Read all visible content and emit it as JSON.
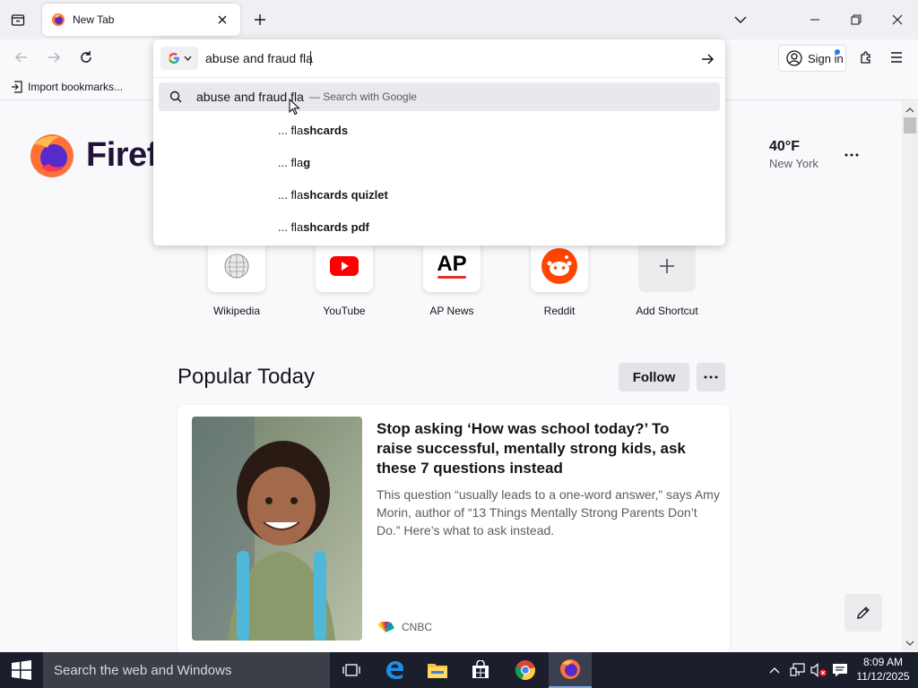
{
  "browser": {
    "tab": {
      "title": "New Tab"
    },
    "signin_label": "Sign in",
    "bookmarks_import": "Import bookmarks..."
  },
  "urlbar": {
    "value": "abuse and fraud fla",
    "main_suggestion": {
      "query": "abuse and fraud fla",
      "action": "— Search with Google"
    },
    "suggestions": [
      {
        "prefix": "... fla",
        "completion": "shcards"
      },
      {
        "prefix": "... fla",
        "completion": "g"
      },
      {
        "prefix": "... fla",
        "completion": "shcards quizlet"
      },
      {
        "prefix": "... fla",
        "completion": "shcards pdf"
      }
    ]
  },
  "newtab": {
    "brand": "Firefox",
    "weather": {
      "temp": "40°F",
      "city": "New York"
    },
    "shortcuts": [
      {
        "label": "Wikipedia",
        "icon": "wikipedia-icon"
      },
      {
        "label": "YouTube",
        "icon": "youtube-icon"
      },
      {
        "label": "AP News",
        "icon": "ap-news-icon"
      },
      {
        "label": "Reddit",
        "icon": "reddit-icon"
      },
      {
        "label": "Add Shortcut",
        "icon": "plus-icon"
      }
    ],
    "popular": {
      "title": "Popular Today",
      "follow_label": "Follow",
      "story": {
        "headline": "Stop asking ‘How was school today?’ To raise successful, mentally strong kids, ask these 7 questions instead",
        "excerpt": "This question “usually leads to a one-word answer,” says Amy Morin, author of “13 Things Mentally Strong Parents Don’t Do.” Here’s what to ask instead.",
        "source": "CNBC"
      }
    }
  },
  "taskbar": {
    "search_placeholder": "Search the web and Windows",
    "time": "8:09 AM",
    "date": "11/12/2025"
  },
  "colors": {
    "accent": "#0060df",
    "firefox_orange": "#ff7139",
    "youtube_red": "#ff0000",
    "reddit_orange": "#ff4500",
    "ap_red": "#e03131",
    "taskbar": "#1a1f2b"
  }
}
